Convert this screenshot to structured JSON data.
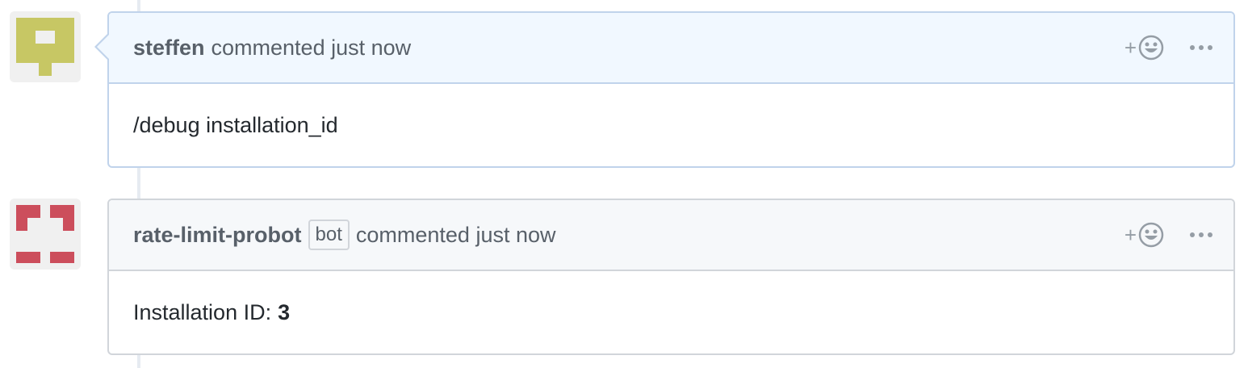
{
  "comments": [
    {
      "author": "steffen",
      "action": "commented just now",
      "body": "/debug installation_id",
      "avatar_color": "#c7c764"
    },
    {
      "author": "rate-limit-probot",
      "badge": "bot",
      "action": "commented just now",
      "body_label": "Installation ID:",
      "body_value": "3",
      "avatar_color": "#cc4e5c"
    }
  ],
  "actions": {
    "reaction_icon": "add-reaction-smiley-icon",
    "reaction_plus": "+",
    "more_icon": "kebab-horizontal-icon"
  },
  "colors": {
    "current_header_bg": "#f1f8ff",
    "current_border": "#c0d3eb",
    "header_bg": "#f6f8fa",
    "border": "#d1d5da"
  }
}
